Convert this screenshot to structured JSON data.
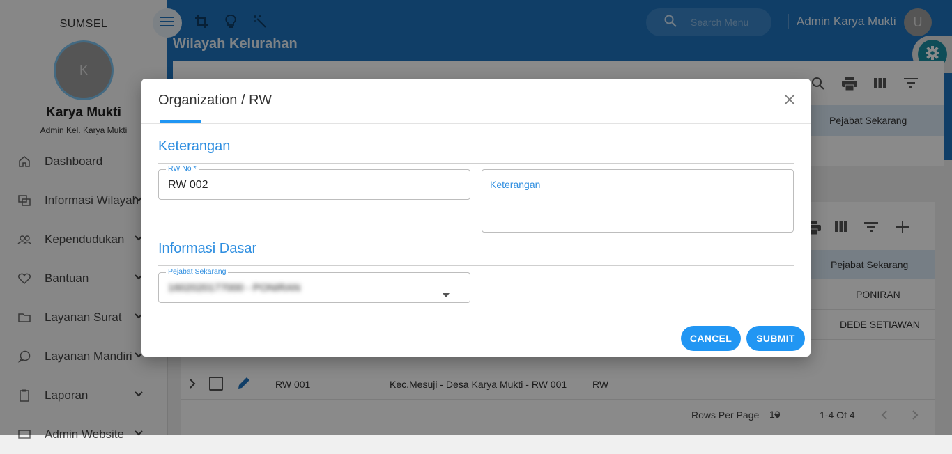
{
  "sidebar": {
    "region": "SUMSEL",
    "avatar_initial": "K",
    "name": "Karya Mukti",
    "role": "Admin Kel. Karya Mukti",
    "items": [
      {
        "label": "Dashboard",
        "icon": "home-icon",
        "has_chevron": false
      },
      {
        "label": "Informasi Wilayah",
        "icon": "layers-icon",
        "has_chevron": true
      },
      {
        "label": "Kependudukan",
        "icon": "people-icon",
        "has_chevron": true
      },
      {
        "label": "Bantuan",
        "icon": "heart-icon",
        "has_chevron": true
      },
      {
        "label": "Layanan Surat",
        "icon": "folder-icon",
        "has_chevron": true
      },
      {
        "label": "Layanan Mandiri",
        "icon": "chat-icon",
        "has_chevron": true
      },
      {
        "label": "Laporan",
        "icon": "clipboard-icon",
        "has_chevron": true
      },
      {
        "label": "Admin Website",
        "icon": "monitor-icon",
        "has_chevron": true
      }
    ]
  },
  "topbar": {
    "search_placeholder": "Search Menu",
    "user_name": "Admin Karya Mukti",
    "user_initial": "U",
    "icons": [
      "menu-icon",
      "crop-icon",
      "lightbulb-icon",
      "magic-wand-icon",
      "search-icon",
      "settings-gear-icon"
    ]
  },
  "page": {
    "title": "Wilayah Kelurahan"
  },
  "table1": {
    "column_pejabat": "Pejabat Sekarang",
    "toolbar_icons": [
      "search-icon",
      "print-icon",
      "columns-icon",
      "filter-icon"
    ]
  },
  "table2": {
    "column_pejabat": "Pejabat Sekarang",
    "toolbar_icons": [
      "print-icon",
      "columns-icon",
      "filter-icon",
      "add-icon"
    ],
    "rows": [
      {
        "pejabat": "PONIRAN"
      },
      {
        "pejabat": "DEDE SETIAWAN"
      },
      {
        "rw": "RW 001",
        "wilayah": "Kec.Mesuji - Desa Karya Mukti - RW 001",
        "tipe": "RW"
      }
    ],
    "footer": {
      "rows_per_page_label": "Rows Per Page",
      "rows_per_page_value": "10",
      "range": "1-4 Of 4"
    }
  },
  "dialog": {
    "title": "Organization / RW",
    "section_keterangan": "Keterangan",
    "rw_no_label": "RW No *",
    "rw_no_value": "RW 002",
    "keterangan_label": "Keterangan",
    "section_informasi": "Informasi Dasar",
    "pejabat_label": "Pejabat Sekarang",
    "pejabat_value": "1602020177000 - PONIRAN",
    "cancel_label": "CANCEL",
    "submit_label": "SUBMIT"
  },
  "colors": {
    "primary": "#2196f3",
    "topbar": "#1f74bf",
    "section_title": "#2e8ee0",
    "gear_button": "#1a8fa3"
  }
}
